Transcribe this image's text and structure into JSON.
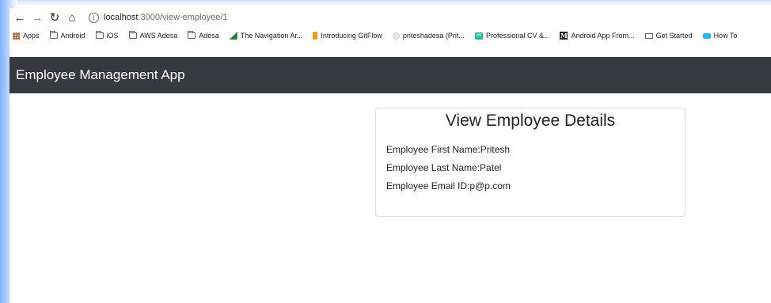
{
  "browser": {
    "url_host": "localhost",
    "url_path": ":3000/view-employee/1",
    "bookmarks": [
      {
        "label": "Apps",
        "icon": "apps-grid-icon"
      },
      {
        "label": "Android",
        "icon": "folder-icon"
      },
      {
        "label": "iOS",
        "icon": "folder-icon"
      },
      {
        "label": "AWS Adesa",
        "icon": "folder-icon"
      },
      {
        "label": "Adesa",
        "icon": "folder-icon"
      },
      {
        "label": "The Navigation Ar...",
        "icon": "bookmark-favicon"
      },
      {
        "label": "Introducing GitFlow",
        "icon": "bookmark-favicon"
      },
      {
        "label": "priteshadesa (Prit...",
        "icon": "github-icon"
      },
      {
        "label": "Professional CV &...",
        "icon": "bookmark-favicon"
      },
      {
        "label": "Android App From...",
        "icon": "medium-icon"
      },
      {
        "label": "Get Started",
        "icon": "bookmark-favicon"
      },
      {
        "label": "How To",
        "icon": "bookmark-favicon"
      }
    ]
  },
  "app": {
    "brand": "Employee Management App"
  },
  "card": {
    "title": "View Employee Details",
    "first_name": "Employee First Name:Pritesh",
    "last_name": "Employee Last Name:Patel",
    "email": "Employee Email ID:p@p.com"
  },
  "colors": {
    "navbar_bg": "#343a40",
    "card_border": "#dcdcdc",
    "text": "#212529"
  }
}
